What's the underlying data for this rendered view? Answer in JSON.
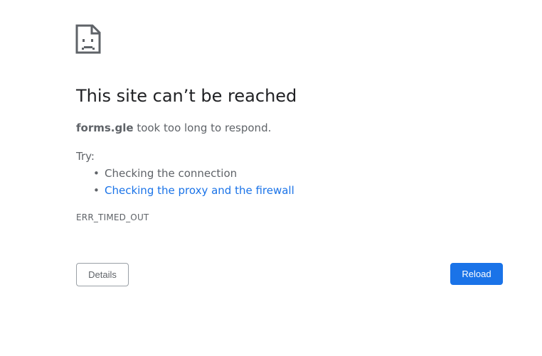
{
  "icon": "sad-document-icon",
  "colors": {
    "link": "#1a73e8",
    "primary_button": "#1a73e8",
    "text_secondary": "#5f6368",
    "title": "#202124"
  },
  "error": {
    "title": "This site can’t be reached",
    "host": "forms.gle",
    "message": " took too long to respond.",
    "try_label": "Try:",
    "suggestions": [
      "Checking the connection",
      "Checking the proxy and the firewall"
    ],
    "code": "ERR_TIMED_OUT"
  },
  "buttons": {
    "details": "Details",
    "reload": "Reload"
  }
}
